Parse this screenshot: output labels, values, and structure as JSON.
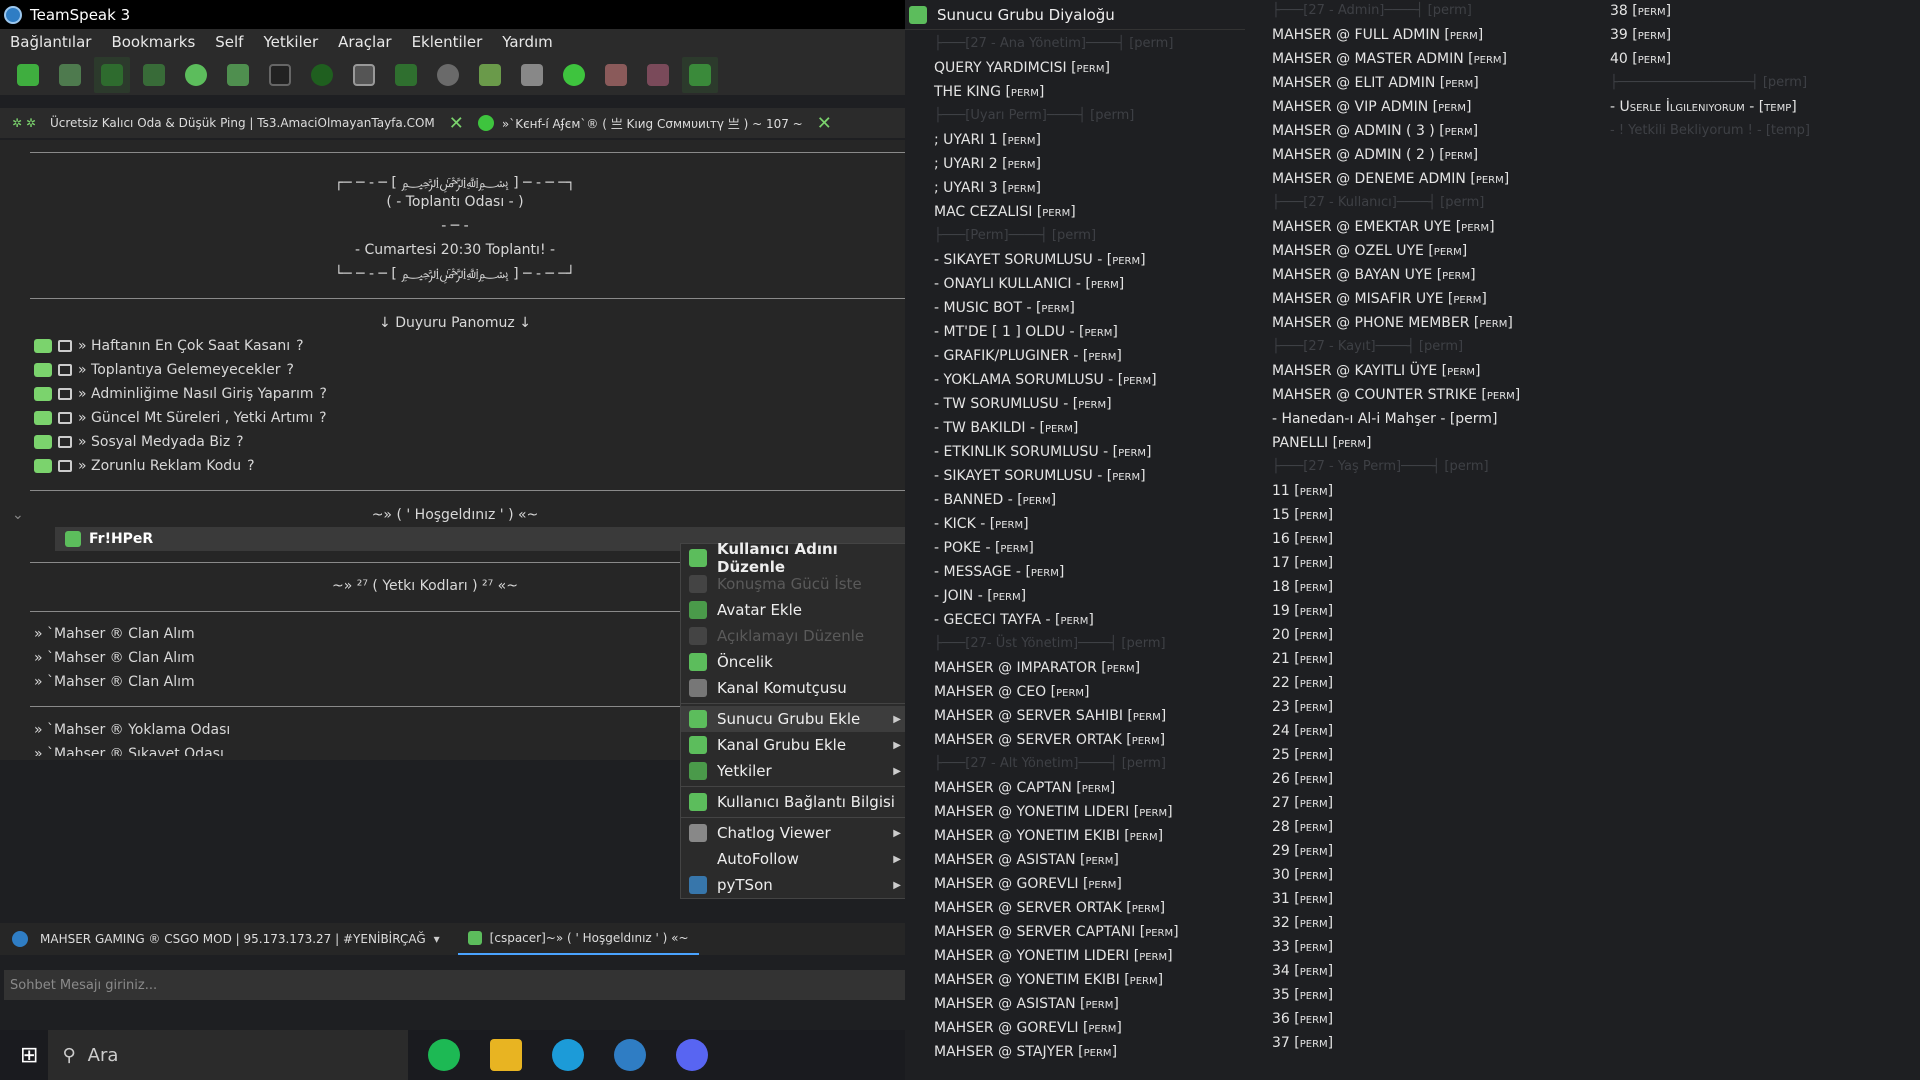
{
  "app": {
    "title": "TeamSpeak 3"
  },
  "menu": [
    "Bağlantılar",
    "Bookmarks",
    "Self",
    "Yetkiler",
    "Araçlar",
    "Eklentiler",
    "Yardım"
  ],
  "toolbar_icons": [
    "connect-icon",
    "disconnect-icon",
    "away-icon",
    "mute-mic-icon",
    "chat-icon",
    "contacts-icon",
    "capture-icon",
    "whisper-icon",
    "record-icon",
    "server-icon",
    "channel-icon",
    "subscribe-icon",
    "ban-icon",
    "add-user-icon",
    "plugin-icon",
    "permission-icon",
    "token-icon",
    "settings-icon"
  ],
  "server_tabs": [
    {
      "label": "Ücretsiz Kalıcı Oda & Düşük Ping | Ts3.AmaciOlmayanTayfa.COM"
    },
    {
      "label": "»`Kєнf-í Aʄєм`® ( 亗 Kıиg Cσммυиιтγ 亗 ) ~ 107 ~"
    }
  ],
  "channels": {
    "banner": [
      "┌─ ─ - ─ [ ﷽ ] ─ - ─ ─┐",
      "( - Toplantı Odası - )",
      "- ─ -",
      "- Cumartesi 20:30 Toplantı! -",
      "└─ ─ - ─ [ ﷽ ] ─ - ─ ─┘"
    ],
    "board_title": "↓ Duyuru Panomuz ↓",
    "board_items": [
      "» Haftanın En Çok Saat Kasanı",
      "» Toplantıya Gelemeyecekler",
      "» Adminliğime Nasıl Giriş Yaparım",
      "» Güncel Mt Süreleri , Yetki Artımı",
      "» Sosyal Medyada Biz",
      "» Zorunlu Reklam Kodu"
    ],
    "welcome": "~» ( ' Hoşgeldınız ' ) «~",
    "user": "Fr!HPeR",
    "codes": "~» ²⁷ ( Yetkı Kodları ) ²⁷ «~",
    "clan_items": [
      "» `Mahser ® Clan Alım",
      "» `Mahser ® Clan Alım",
      "» `Mahser ® Clan Alım"
    ],
    "yoklama": "» `Mahser ® Yoklama Odası",
    "partial": "» `Mahser ® Sıkayet Odası"
  },
  "context_menu": [
    {
      "label": "Kullanıcı Adını Düzenle",
      "bold": true,
      "disabled": false,
      "sub": false
    },
    {
      "label": "Konuşma Gücü İste",
      "disabled": true,
      "sub": false
    },
    {
      "label": "Avatar Ekle",
      "disabled": false,
      "sub": false
    },
    {
      "label": "Açıklamayı Düzenle",
      "disabled": true,
      "sub": false
    },
    {
      "label": "Öncelik",
      "disabled": false,
      "sub": false
    },
    {
      "label": "Kanal Komutçusu",
      "disabled": false,
      "sub": false
    },
    {
      "label": "Sunucu Grubu Ekle",
      "disabled": false,
      "sub": true,
      "highlight": true
    },
    {
      "label": "Kanal Grubu Ekle",
      "disabled": false,
      "sub": true
    },
    {
      "label": "Yetkiler",
      "disabled": false,
      "sub": true
    },
    {
      "label": "Kullanıcı Bağlantı Bilgisi",
      "disabled": false,
      "sub": false
    },
    {
      "label": "Chatlog Viewer",
      "disabled": false,
      "sub": true
    },
    {
      "label": "AutoFollow",
      "disabled": false,
      "sub": true
    },
    {
      "label": "pyTSon",
      "disabled": false,
      "sub": true
    }
  ],
  "bottom_tabs": [
    {
      "label": "MAHSER GAMING ® CSGO MOD | 95.173.173.27 | #YENİBİRÇAĞ"
    },
    {
      "label": "[cspacer]~» ( ' Hoşgeldınız ' ) «~"
    }
  ],
  "chat_placeholder": "Sohbet Mesajı giriniz...",
  "taskbar": {
    "search": "Ara"
  },
  "dialog": {
    "title": "Sunucu Grubu Diyaloğu",
    "col1": [
      {
        "t": "├───[27 - Ana Yönetim]────┤ [perm]",
        "dim": true
      },
      {
        "t": "QUERY YARDIMCISI [perm]"
      },
      {
        "t": "THE KING [perm]"
      },
      {
        "t": "├───[Uyarı Perm]────┤ [perm]",
        "dim": true
      },
      {
        "t": "; UYARI 1 [perm]"
      },
      {
        "t": "; UYARI 2 [perm]"
      },
      {
        "t": "; UYARI 3 [perm]"
      },
      {
        "t": "MAC CEZALISI [perm]"
      },
      {
        "t": "├───[Perm]────┤ [perm]",
        "dim": true
      },
      {
        "t": "- SIKAYET SORUMLUSU - [perm]"
      },
      {
        "t": "- ONAYLI KULLANICI - [perm]"
      },
      {
        "t": "- MUSIC BOT - [perm]"
      },
      {
        "t": "- MT'DE [ 1 ] OLDU - [perm]"
      },
      {
        "t": "- GRAFIK/PLUGINER - [perm]"
      },
      {
        "t": "- YOKLAMA SORUMLUSU - [perm]"
      },
      {
        "t": "- TW SORUMLUSU - [perm]"
      },
      {
        "t": "- TW BAKILDI - [perm]"
      },
      {
        "t": "- ETKINLIK SORUMLUSU - [perm]"
      },
      {
        "t": "- SIKAYET SORUMLUSU - [perm]"
      },
      {
        "t": "- BANNED - [perm]"
      },
      {
        "t": "- KICK - [perm]"
      },
      {
        "t": "- POKE - [perm]"
      },
      {
        "t": "- MESSAGE - [perm]"
      },
      {
        "t": "- JOIN - [perm]"
      },
      {
        "t": "- GECECI TAYFA - [perm]"
      },
      {
        "t": "├───[27- Üst Yönetim]────┤ [perm]",
        "dim": true
      },
      {
        "t": "MAHSER @ IMPARATOR [perm]"
      },
      {
        "t": "MAHSER @ CEO [perm]"
      },
      {
        "t": "MAHSER @ SERVER SAHIBI [perm]"
      },
      {
        "t": "MAHSER @ SERVER ORTAK [perm]"
      },
      {
        "t": "├───[27 - Alt Yönetim]────┤ [perm]",
        "dim": true
      },
      {
        "t": "MAHSER @ CAPTAN [perm]"
      },
      {
        "t": "MAHSER @ YONETIM LIDERI [perm]"
      },
      {
        "t": "MAHSER @ YONETIM EKIBI [perm]"
      },
      {
        "t": "MAHSER @ ASISTAN [perm]"
      },
      {
        "t": "MAHSER @ GOREVLI [perm]"
      },
      {
        "t": "MAHSER @ SERVER ORTAK [perm]"
      },
      {
        "t": "MAHSER @ SERVER CAPTANI [perm]"
      },
      {
        "t": "MAHSER @ YONETIM LIDERI [perm]"
      },
      {
        "t": "MAHSER @ YONETIM EKIBI [perm]"
      },
      {
        "t": "MAHSER @ ASISTAN [perm]"
      },
      {
        "t": "MAHSER @ GOREVLI [perm]"
      },
      {
        "t": "MAHSER @ STAJYER [perm]"
      }
    ],
    "col2": [
      {
        "t": "├───[27 - Admin]────┤ [perm]",
        "dim": true
      },
      {
        "t": "MAHSER @ FULL ADMIN [perm]"
      },
      {
        "t": "MAHSER @ MASTER ADMIN [perm]"
      },
      {
        "t": "MAHSER @ ELIT ADMIN [perm]"
      },
      {
        "t": "MAHSER @ VIP ADMIN [perm]"
      },
      {
        "t": "MAHSER @ ADMIN ( 3 ) [perm]"
      },
      {
        "t": "MAHSER @ ADMIN ( 2 ) [perm]"
      },
      {
        "t": "MAHSER @ DENEME ADMIN [perm]"
      },
      {
        "t": "├───[27 - Kullanıcı]────┤ [perm]",
        "dim": true
      },
      {
        "t": "MAHSER @ EMEKTAR UYE [perm]"
      },
      {
        "t": "MAHSER @ OZEL UYE [perm]"
      },
      {
        "t": "MAHSER @ BAYAN UYE [perm]"
      },
      {
        "t": "MAHSER @ MISAFIR UYE [perm]"
      },
      {
        "t": "MAHSER @ PHONE MEMBER [perm]"
      },
      {
        "t": "├───[27 - Kayıt]────┤ [perm]",
        "dim": true
      },
      {
        "t": "MAHSER @ KAYITLI ÜYE [perm]"
      },
      {
        "t": "MAHSER @ COUNTER STRIKE [perm]"
      },
      {
        "t": "- Hanedan-ı Al-i Mahşer - [perm]",
        "plain": true
      },
      {
        "t": "PANELLI [perm]"
      },
      {
        "t": "├───[27 - Yaş Perm]────┤ [perm]",
        "dim": true
      },
      {
        "t": "11 [perm]"
      },
      {
        "t": "15 [perm]"
      },
      {
        "t": "16 [perm]"
      },
      {
        "t": "17 [perm]"
      },
      {
        "t": "18 [perm]"
      },
      {
        "t": "19 [perm]"
      },
      {
        "t": "20 [perm]"
      },
      {
        "t": "21 [perm]"
      },
      {
        "t": "22 [perm]"
      },
      {
        "t": "23 [perm]"
      },
      {
        "t": "24 [perm]"
      },
      {
        "t": "25 [perm]"
      },
      {
        "t": "26 [perm]"
      },
      {
        "t": "27 [perm]"
      },
      {
        "t": "28 [perm]"
      },
      {
        "t": "29 [perm]"
      },
      {
        "t": "30 [perm]"
      },
      {
        "t": "31 [perm]"
      },
      {
        "t": "32 [perm]"
      },
      {
        "t": "33 [perm]"
      },
      {
        "t": "34 [perm]"
      },
      {
        "t": "35 [perm]"
      },
      {
        "t": "36 [perm]"
      },
      {
        "t": "37 [perm]"
      }
    ],
    "col3": [
      {
        "t": "38 [perm]"
      },
      {
        "t": "39 [perm]"
      },
      {
        "t": "40 [perm]"
      },
      {
        "t": "├─────────────────┤ [perm]",
        "dim": true
      },
      {
        "t": "- Userle İlgileniyorum - [temp]"
      },
      {
        "t": "- ! Yetkili Bekliyorum ! - [temp]",
        "dim": true
      }
    ]
  },
  "colors": {
    "accent": "#7bd36d",
    "highlight": "#3d3d3d",
    "dim": "#3e4045"
  }
}
